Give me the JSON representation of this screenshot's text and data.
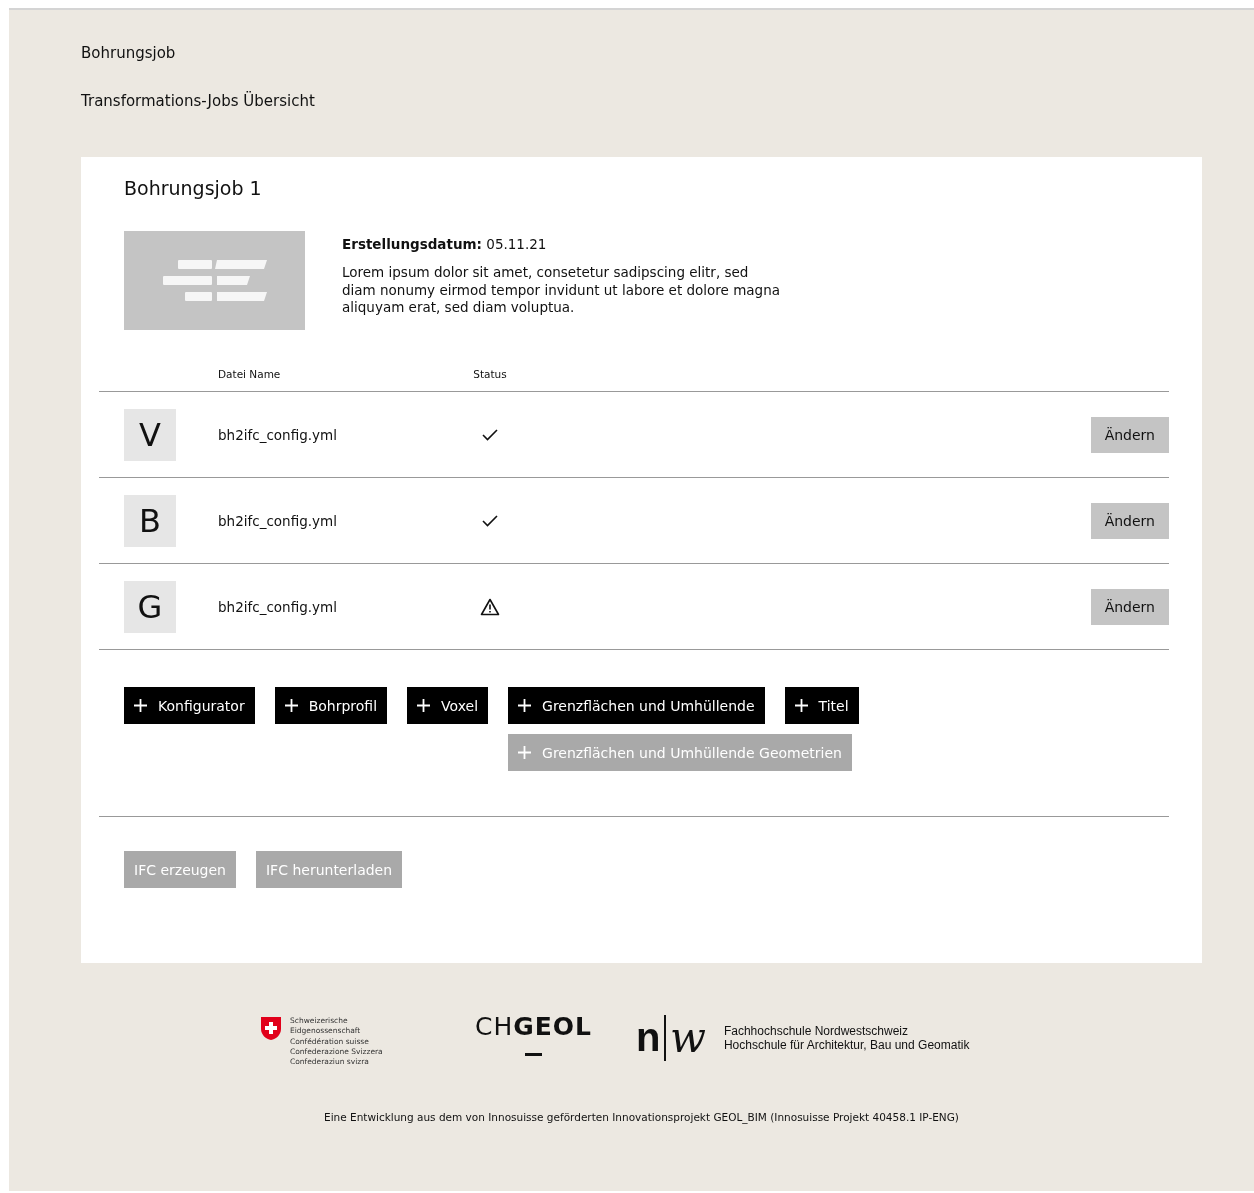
{
  "breadcrumbs": [
    "Bohrungsjob",
    "Transformations-Jobs Übersicht"
  ],
  "job": {
    "title": "Bohrungsjob 1",
    "date_label": "Erstellungsdatum:",
    "date": "05.11.21",
    "description": "Lorem ipsum dolor sit amet, consetetur sadipscing elitr, sed diam nonumy eirmod tempor invidunt ut labore et dolore magna aliquyam erat, sed diam voluptua."
  },
  "table": {
    "columns": [
      "Datei Name",
      "Status"
    ],
    "rows": [
      {
        "letter": "V",
        "file": "bh2ifc_config.yml",
        "warning": false,
        "action": "Ändern"
      },
      {
        "letter": "B",
        "file": "bh2ifc_config.yml",
        "warning": false,
        "action": "Ändern"
      },
      {
        "letter": "G",
        "file": "bh2ifc_config.yml",
        "warning": true,
        "action": "Ändern"
      }
    ]
  },
  "add_buttons": [
    {
      "label": "Konfigurator",
      "disabled": false
    },
    {
      "label": "Bohrprofil",
      "disabled": false
    },
    {
      "label": "Voxel",
      "disabled": false
    },
    {
      "label": "Grenzflächen und Umhüllende",
      "disabled": false,
      "sub": {
        "label": "Grenzflächen und Umhüllende Geometrien",
        "disabled": true
      }
    },
    {
      "label": "Titel",
      "disabled": false
    }
  ],
  "actions": [
    {
      "label": "IFC erzeugen",
      "disabled": true
    },
    {
      "label": "IFC herunterladen",
      "disabled": true
    }
  ],
  "footer": {
    "swiss_lines": [
      "Schweizerische Eidgenossenschaft",
      "Confédération suisse",
      "Confederazione Svizzera",
      "Confederaziun svizra"
    ],
    "chgeol": "CH**GEOL**",
    "fhnw_n": "n",
    "fhnw_w": "w",
    "fhnw_lines": [
      "Fachhochschule Nordwestschweiz",
      "Hochschule für Architektur, Bau und Geomatik"
    ],
    "note": "Eine Entwicklung aus dem von Innosuisse geförderten Innovationsprojekt GEOL_BIM (Innosuisse Projekt 40458.1 IP-ENG)"
  }
}
